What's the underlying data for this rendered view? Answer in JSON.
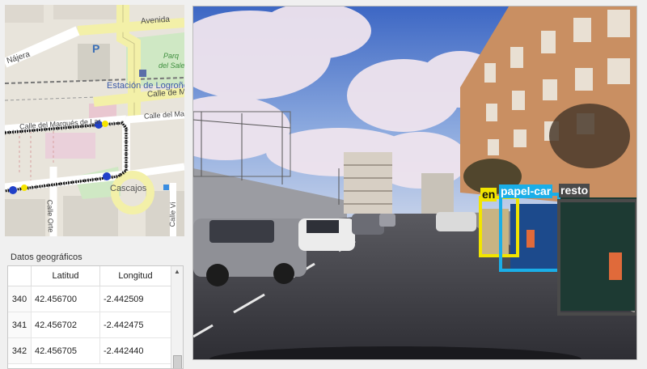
{
  "map": {
    "streets": {
      "avenida": "Avenida",
      "najera": "Nájera",
      "calle_de_m": "Calle de M",
      "calle_del_ma": "Calle del Ma",
      "calle_marques": "Calle del Marqués de Lar",
      "cascajos": "Cascajos",
      "calle_orte": "Calle Orte",
      "calle_vi": "Calle Vi"
    },
    "station": "Estación de Logroño",
    "park_1": "Parq",
    "park_2": "del Salero",
    "parking_letter": "P"
  },
  "geo_panel": {
    "title": "Datos geográficos",
    "columns": [
      "Latitud",
      "Longitud"
    ],
    "rows": [
      {
        "id": "340",
        "lat": "42.456700",
        "lon": "-2.442509"
      },
      {
        "id": "341",
        "lat": "42.456702",
        "lon": "-2.442475"
      },
      {
        "id": "342",
        "lat": "42.456705",
        "lon": "-2.442440"
      }
    ]
  },
  "detections": [
    {
      "label": "en",
      "color": "#f2e500"
    },
    {
      "label": "papel-car",
      "color": "#1aaee8"
    },
    {
      "label": "resto",
      "color": "#4a4a4a"
    }
  ],
  "colors": {
    "track": "#111111",
    "track_marker": "#2040c8",
    "marker_yellow": "#f5e400"
  }
}
